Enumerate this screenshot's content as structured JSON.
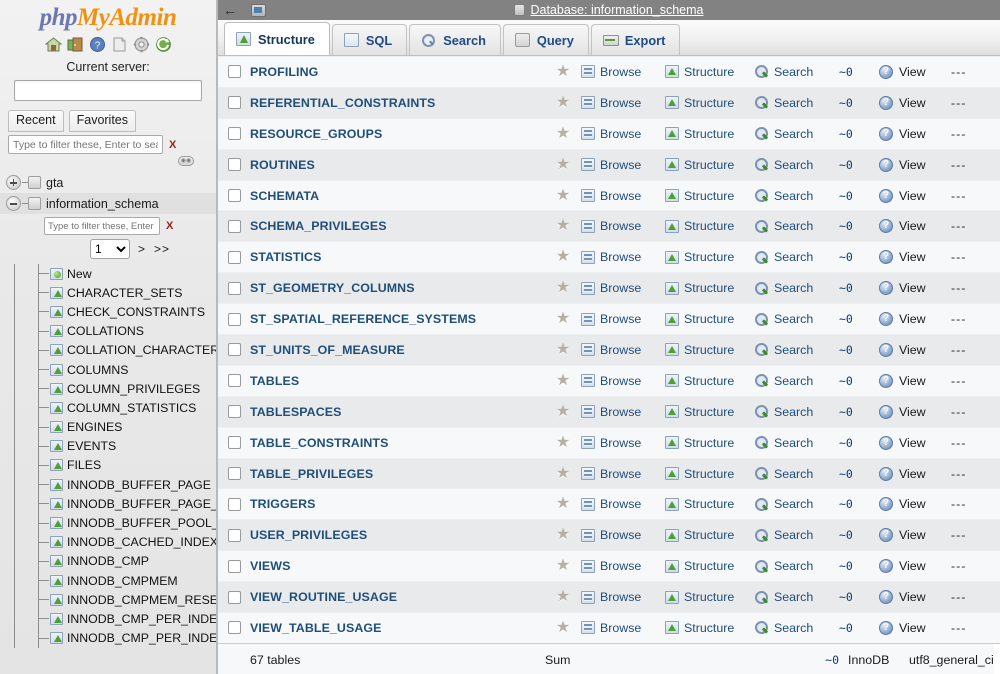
{
  "sidebar": {
    "logo": {
      "part1": "php",
      "part2": "My",
      "part3": "Admin"
    },
    "logo_icons": [
      {
        "name": "home-icon",
        "glyph": "home"
      },
      {
        "name": "logout-icon",
        "glyph": "door"
      },
      {
        "name": "documentation-icon",
        "glyph": "question"
      },
      {
        "name": "docs-page-icon",
        "glyph": "page"
      },
      {
        "name": "settings-gear-icon",
        "glyph": "gear"
      },
      {
        "name": "reload-icon",
        "glyph": "refresh"
      }
    ],
    "current_server_label": "Current server:",
    "server_select_value": "",
    "tabs": [
      {
        "label": "Recent",
        "name": "recent-tab"
      },
      {
        "label": "Favorites",
        "name": "favorites-tab"
      }
    ],
    "filter": {
      "value": "",
      "placeholder": "Type to filter these, Enter to search al",
      "clear_label": "X"
    },
    "databases": [
      {
        "label": "gta",
        "expanded": false,
        "selected": false
      },
      {
        "label": "information_schema",
        "expanded": true,
        "selected": true
      }
    ],
    "db_filter": {
      "value": "",
      "placeholder": "Type to filter these, Enter to s",
      "clear_label": "X"
    },
    "pager": {
      "page_value": "1",
      "options": [
        "1"
      ],
      "next_label": ">",
      "last_label": ">>"
    },
    "table_items": [
      {
        "label": "New",
        "icon": "new-table-icon"
      },
      {
        "label": "CHARACTER_SETS",
        "icon": "table-icon"
      },
      {
        "label": "CHECK_CONSTRAINTS",
        "icon": "table-icon"
      },
      {
        "label": "COLLATIONS",
        "icon": "table-icon"
      },
      {
        "label": "COLLATION_CHARACTER_",
        "icon": "table-icon"
      },
      {
        "label": "COLUMNS",
        "icon": "table-icon"
      },
      {
        "label": "COLUMN_PRIVILEGES",
        "icon": "table-icon"
      },
      {
        "label": "COLUMN_STATISTICS",
        "icon": "table-icon"
      },
      {
        "label": "ENGINES",
        "icon": "table-icon"
      },
      {
        "label": "EVENTS",
        "icon": "table-icon"
      },
      {
        "label": "FILES",
        "icon": "table-icon"
      },
      {
        "label": "INNODB_BUFFER_PAGE",
        "icon": "table-icon"
      },
      {
        "label": "INNODB_BUFFER_PAGE_LI",
        "icon": "table-icon"
      },
      {
        "label": "INNODB_BUFFER_POOL_S",
        "icon": "table-icon"
      },
      {
        "label": "INNODB_CACHED_INDEXE",
        "icon": "table-icon"
      },
      {
        "label": "INNODB_CMP",
        "icon": "table-icon"
      },
      {
        "label": "INNODB_CMPMEM",
        "icon": "table-icon"
      },
      {
        "label": "INNODB_CMPMEM_RESET",
        "icon": "table-icon"
      },
      {
        "label": "INNODB_CMP_PER_INDEX",
        "icon": "table-icon"
      },
      {
        "label": "INNODB_CMP_PER_INDEX",
        "icon": "table-icon"
      }
    ]
  },
  "main": {
    "topbar": {
      "back_label": "←",
      "window_icon": "window-icon",
      "breadcrumb_db_icon": "database-icon",
      "breadcrumb": "Database: information_schema"
    },
    "tabs": [
      {
        "label": "Structure",
        "icon": "structure-icon",
        "active": true
      },
      {
        "label": "SQL",
        "icon": "sql-icon",
        "active": false
      },
      {
        "label": "Search",
        "icon": "search-icon",
        "active": false
      },
      {
        "label": "Query",
        "icon": "query-icon",
        "active": false
      },
      {
        "label": "Export",
        "icon": "export-icon",
        "active": false
      }
    ],
    "actions": {
      "browse": "Browse",
      "structure": "Structure",
      "search": "Search",
      "view": "View",
      "dash": "---"
    },
    "rows": [
      {
        "name": "PROFILING",
        "rows": "~0",
        "extra": "---"
      },
      {
        "name": "REFERENTIAL_CONSTRAINTS",
        "rows": "~0",
        "extra": "---"
      },
      {
        "name": "RESOURCE_GROUPS",
        "rows": "~0",
        "extra": "---"
      },
      {
        "name": "ROUTINES",
        "rows": "~0",
        "extra": "---"
      },
      {
        "name": "SCHEMATA",
        "rows": "~0",
        "extra": "---"
      },
      {
        "name": "SCHEMA_PRIVILEGES",
        "rows": "~0",
        "extra": "---"
      },
      {
        "name": "STATISTICS",
        "rows": "~0",
        "extra": "---"
      },
      {
        "name": "ST_GEOMETRY_COLUMNS",
        "rows": "~0",
        "extra": "---"
      },
      {
        "name": "ST_SPATIAL_REFERENCE_SYSTEMS",
        "rows": "~0",
        "extra": "---"
      },
      {
        "name": "ST_UNITS_OF_MEASURE",
        "rows": "~0",
        "extra": "---"
      },
      {
        "name": "TABLES",
        "rows": "~0",
        "extra": "---"
      },
      {
        "name": "TABLESPACES",
        "rows": "~0",
        "extra": "---"
      },
      {
        "name": "TABLE_CONSTRAINTS",
        "rows": "~0",
        "extra": "---"
      },
      {
        "name": "TABLE_PRIVILEGES",
        "rows": "~0",
        "extra": "---"
      },
      {
        "name": "TRIGGERS",
        "rows": "~0",
        "extra": "---"
      },
      {
        "name": "USER_PRIVILEGES",
        "rows": "~0",
        "extra": "---"
      },
      {
        "name": "VIEWS",
        "rows": "~0",
        "extra": "---"
      },
      {
        "name": "VIEW_ROUTINE_USAGE",
        "rows": "~0",
        "extra": "---"
      },
      {
        "name": "VIEW_TABLE_USAGE",
        "rows": "~0",
        "extra": "---"
      }
    ],
    "footer": {
      "tables_count": "67 tables",
      "sum_label": "Sum",
      "sum_rows": "~0",
      "engine": "InnoDB",
      "collation": "utf8_general_ci"
    }
  }
}
